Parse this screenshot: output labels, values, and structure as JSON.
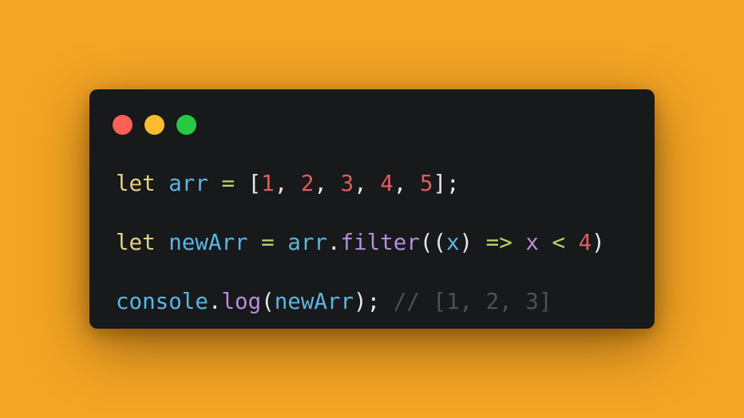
{
  "window": {
    "background": "#17191B",
    "traffic_lights": [
      {
        "name": "close",
        "color": "#FE5F57"
      },
      {
        "name": "minimize",
        "color": "#FEBC2E"
      },
      {
        "name": "maximize",
        "color": "#28C840"
      }
    ]
  },
  "page_background": "#F4A524",
  "code": {
    "lines": [
      [
        {
          "t": "let",
          "c": "#E5D085"
        },
        {
          "t": " ",
          "c": "#E8E8E8"
        },
        {
          "t": "arr",
          "c": "#5BB6E2"
        },
        {
          "t": " ",
          "c": "#E8E8E8"
        },
        {
          "t": "=",
          "c": "#BCD36B"
        },
        {
          "t": " [",
          "c": "#E8E8E8"
        },
        {
          "t": "1",
          "c": "#E25C5C"
        },
        {
          "t": ", ",
          "c": "#E8E8E8"
        },
        {
          "t": "2",
          "c": "#E25C5C"
        },
        {
          "t": ", ",
          "c": "#E8E8E8"
        },
        {
          "t": "3",
          "c": "#E25C5C"
        },
        {
          "t": ", ",
          "c": "#E8E8E8"
        },
        {
          "t": "4",
          "c": "#E25C5C"
        },
        {
          "t": ", ",
          "c": "#E8E8E8"
        },
        {
          "t": "5",
          "c": "#E25C5C"
        },
        {
          "t": "];",
          "c": "#E8E8E8"
        }
      ],
      [],
      [
        {
          "t": "let",
          "c": "#E5D085"
        },
        {
          "t": " ",
          "c": "#E8E8E8"
        },
        {
          "t": "newArr",
          "c": "#5BB6E2"
        },
        {
          "t": " ",
          "c": "#E8E8E8"
        },
        {
          "t": "=",
          "c": "#BCD36B"
        },
        {
          "t": " ",
          "c": "#E8E8E8"
        },
        {
          "t": "arr",
          "c": "#5BB6E2"
        },
        {
          "t": ".",
          "c": "#E8E8E8"
        },
        {
          "t": "filter",
          "c": "#B48EDB"
        },
        {
          "t": "((",
          "c": "#E8E8E8"
        },
        {
          "t": "x",
          "c": "#5BB6E2"
        },
        {
          "t": ") ",
          "c": "#E8E8E8"
        },
        {
          "t": "=>",
          "c": "#BCD36B"
        },
        {
          "t": " ",
          "c": "#E8E8E8"
        },
        {
          "t": "x",
          "c": "#B48EDB"
        },
        {
          "t": " ",
          "c": "#E8E8E8"
        },
        {
          "t": "<",
          "c": "#BCD36B"
        },
        {
          "t": " ",
          "c": "#E8E8E8"
        },
        {
          "t": "4",
          "c": "#E25C5C"
        },
        {
          "t": ")",
          "c": "#E8E8E8"
        }
      ],
      [],
      [
        {
          "t": "console",
          "c": "#5BB6E2"
        },
        {
          "t": ".",
          "c": "#E8E8E8"
        },
        {
          "t": "log",
          "c": "#B48EDB"
        },
        {
          "t": "(",
          "c": "#E8E8E8"
        },
        {
          "t": "newArr",
          "c": "#5BB6E2"
        },
        {
          "t": "); ",
          "c": "#E8E8E8"
        },
        {
          "t": "// [1, 2, 3]",
          "c": "#4A5359"
        }
      ]
    ]
  }
}
